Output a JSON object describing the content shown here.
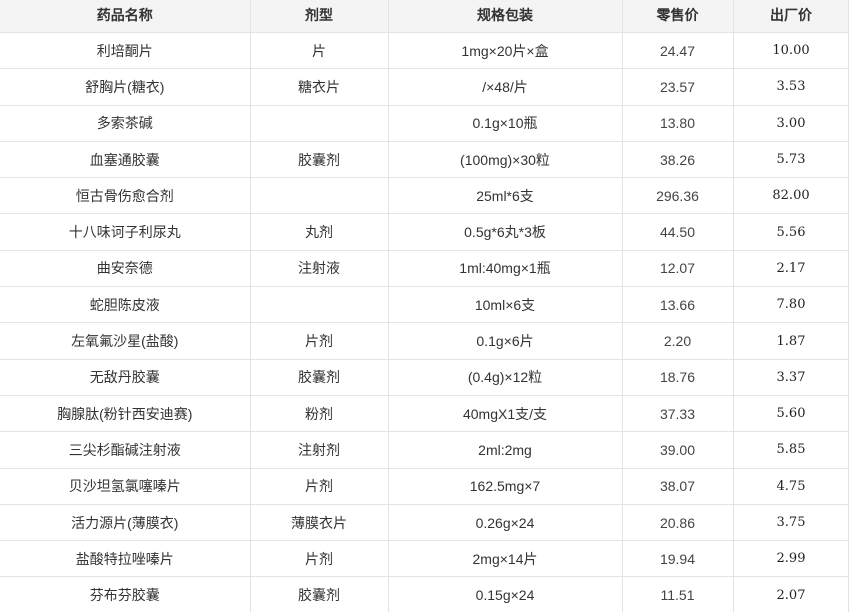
{
  "headers": [
    "药品名称",
    "剂型",
    "规格包装",
    "零售价",
    "出厂价"
  ],
  "rows": [
    [
      "利培酮片",
      "片",
      "1mg×20片×盒",
      "24.47",
      "10.00"
    ],
    [
      "舒胸片(糖衣)",
      "糖衣片",
      "/×48/片",
      "23.57",
      "3.53"
    ],
    [
      "多索茶碱",
      "",
      "0.1g×10瓶",
      "13.80",
      "3.00"
    ],
    [
      "血塞通胶囊",
      "胶囊剂",
      "(100mg)×30粒",
      "38.26",
      "5.73"
    ],
    [
      "恒古骨伤愈合剂",
      "",
      "25ml*6支",
      "296.36",
      "82.00"
    ],
    [
      "十八味诃子利尿丸",
      "丸剂",
      "0.5g*6丸*3板",
      "44.50",
      "5.56"
    ],
    [
      "曲安奈德",
      "注射液",
      "1ml:40mg×1瓶",
      "12.07",
      "2.17"
    ],
    [
      "蛇胆陈皮液",
      "",
      "10ml×6支",
      "13.66",
      "7.80"
    ],
    [
      "左氧氟沙星(盐酸)",
      "片剂",
      "0.1g×6片",
      "2.20",
      "1.87"
    ],
    [
      "无敌丹胶囊",
      "胶囊剂",
      "(0.4g)×12粒",
      "18.76",
      "3.37"
    ],
    [
      "胸腺肽(粉针西安迪赛)",
      "粉剂",
      "40mgX1支/支",
      "37.33",
      "5.60"
    ],
    [
      "三尖杉酯碱注射液",
      "注射剂",
      "2ml:2mg",
      "39.00",
      "5.85"
    ],
    [
      "贝沙坦氢氯噻嗪片",
      "片剂",
      "162.5mg×7",
      "38.07",
      "4.75"
    ],
    [
      "活力源片(薄膜衣)",
      "薄膜衣片",
      "0.26g×24",
      "20.86",
      "3.75"
    ],
    [
      "盐酸特拉唑嗪片",
      "片剂",
      "2mg×14片",
      "19.94",
      "2.99"
    ],
    [
      "芬布芬胶囊",
      "胶囊剂",
      "0.15g×24",
      "11.51",
      "2.07"
    ]
  ]
}
